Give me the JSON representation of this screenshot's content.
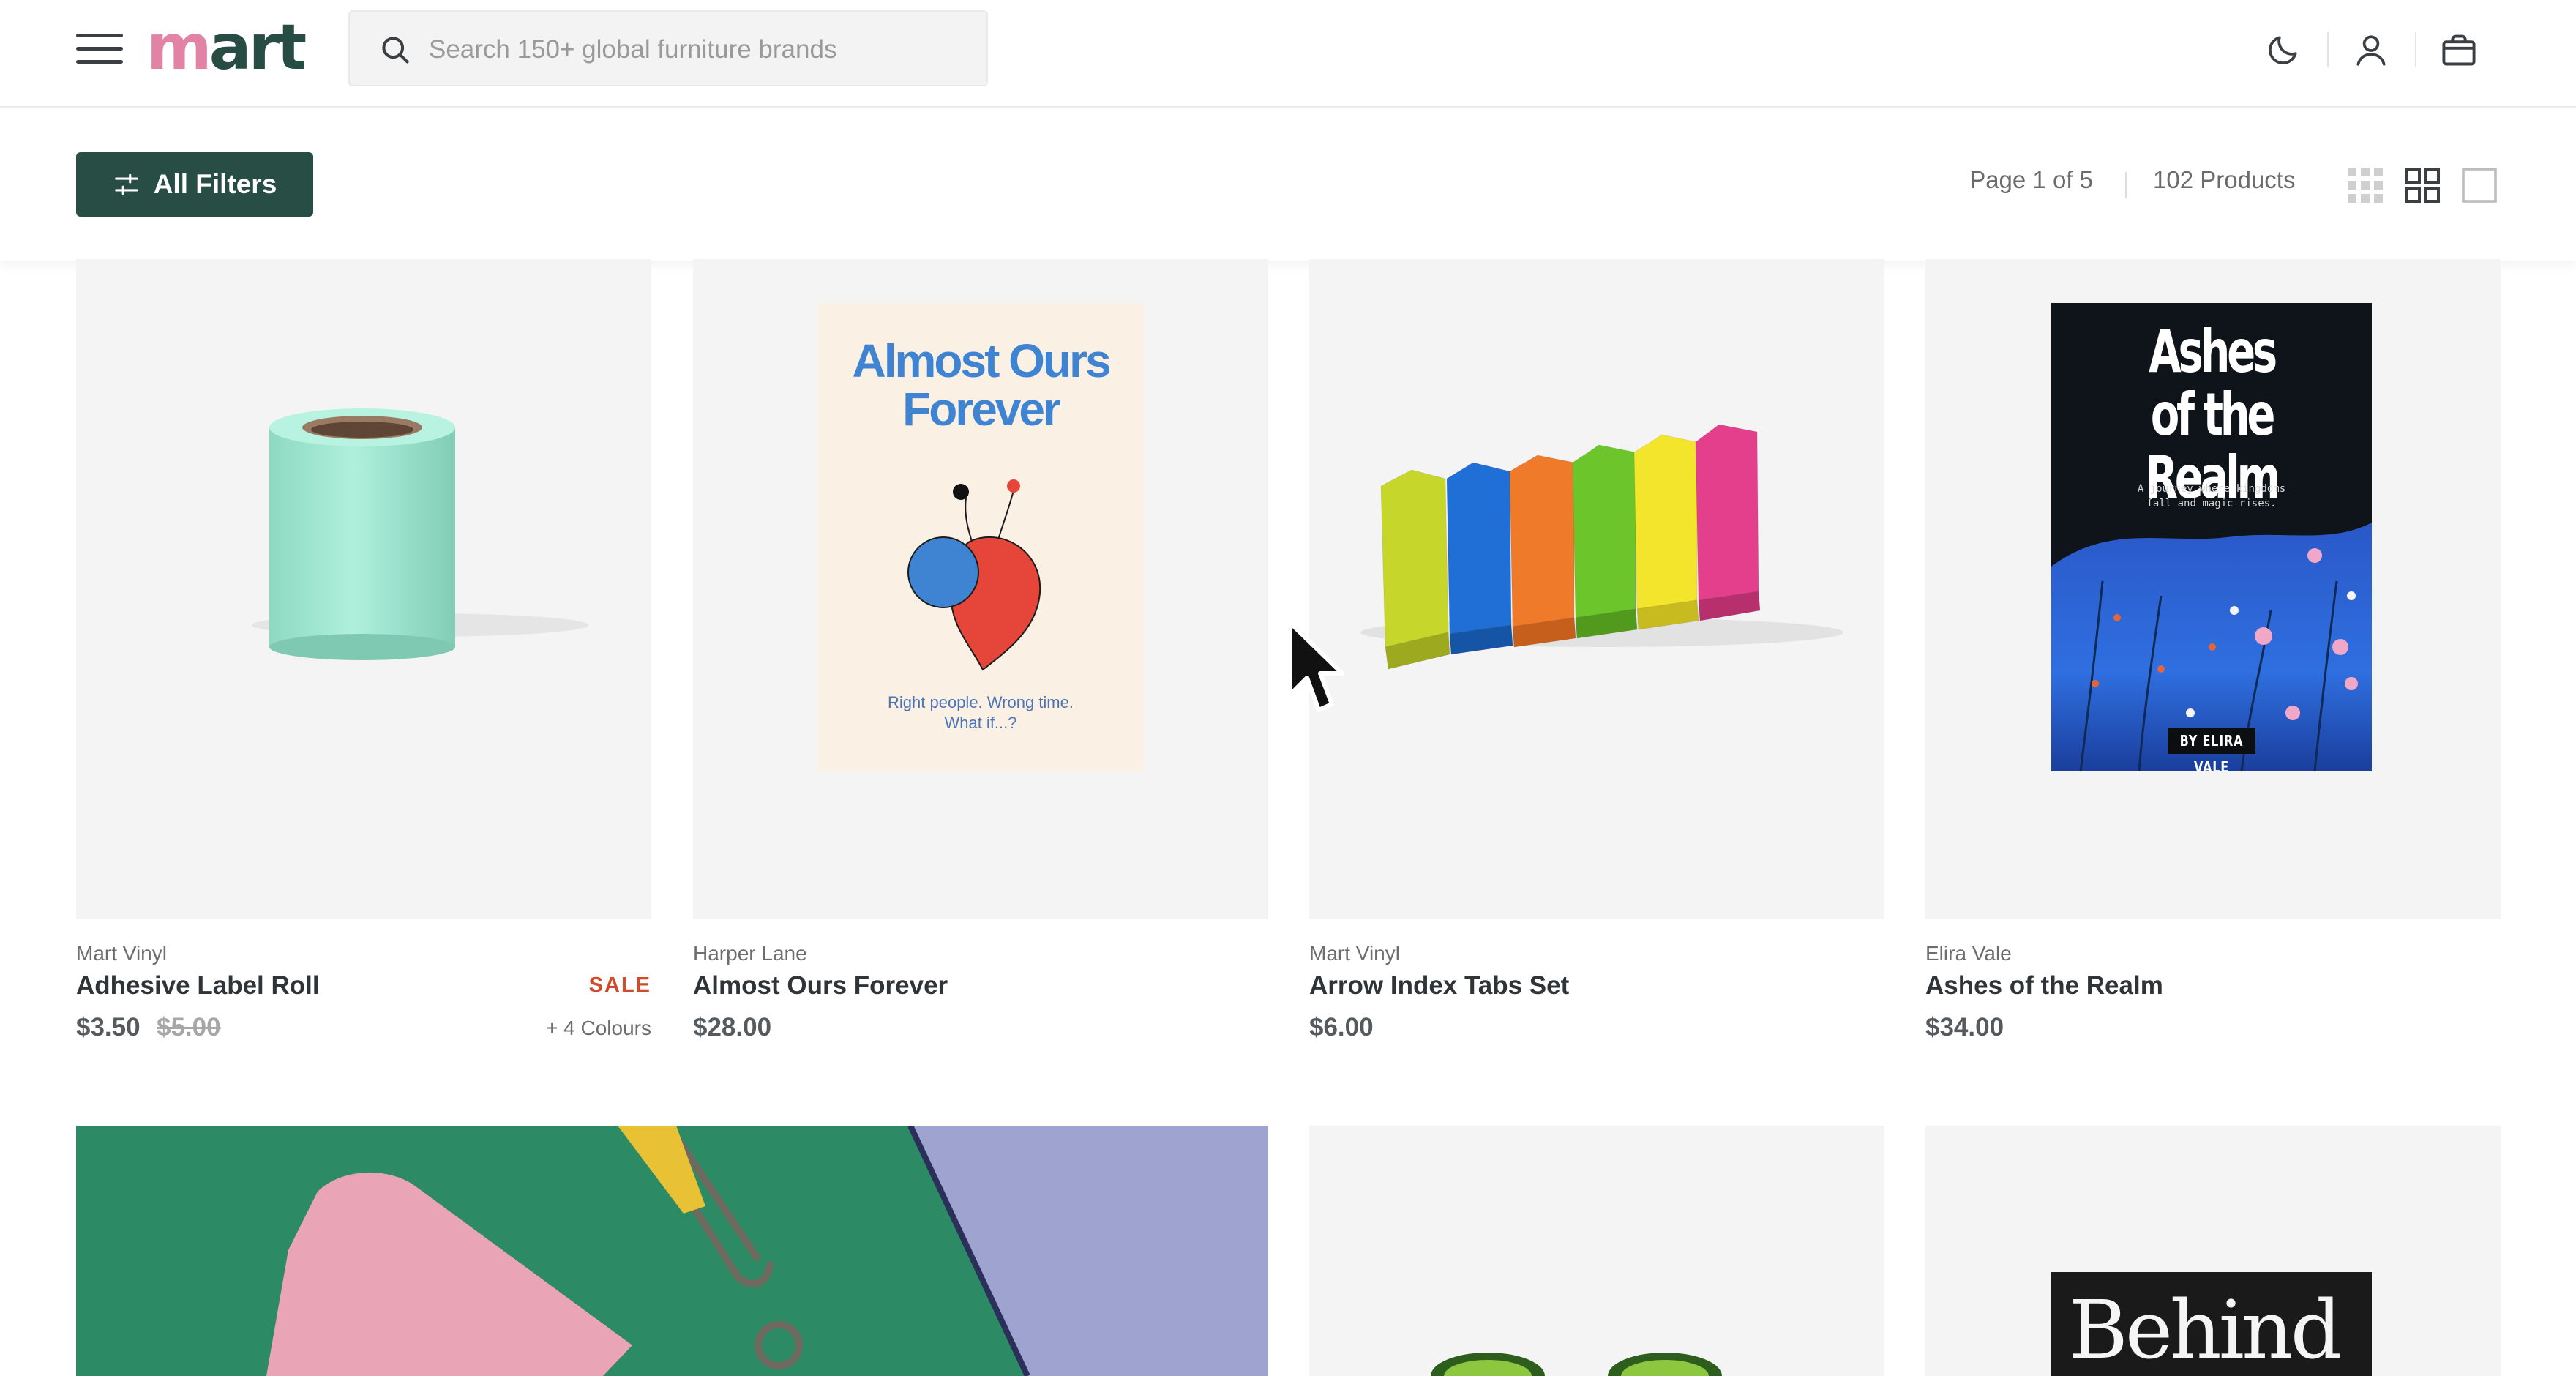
{
  "header": {
    "logo_part1": "m",
    "logo_part2": "art",
    "search_placeholder": "Search 150+ global furniture brands",
    "icons": [
      "menu-icon",
      "search-icon",
      "moon-icon",
      "user-icon",
      "bag-icon"
    ]
  },
  "toolbar": {
    "filters_label": "All Filters",
    "page_info": "Page 1 of 5",
    "product_count": "102 Products",
    "view_options": [
      "grid-small-view",
      "grid-medium-view",
      "single-view"
    ]
  },
  "products": [
    {
      "brand": "Mart Vinyl",
      "name": "Adhesive Label Roll",
      "price": "$3.50",
      "old_price": "$5.00",
      "badge": "SALE",
      "colours": "+ 4 Colours",
      "sale_color": "#cf4b2b"
    },
    {
      "brand": "Harper Lane",
      "name": "Almost Ours Forever",
      "price": "$28.00",
      "cover_title_line1": "Almost Ours",
      "cover_title_line2": "Forever",
      "cover_sub_line1": "Right people. Wrong time.",
      "cover_sub_line2": "What if...?"
    },
    {
      "brand": "Mart Vinyl",
      "name": "Arrow Index Tabs Set",
      "price": "$6.00"
    },
    {
      "brand": "Elira Vale",
      "name": "Ashes of the Realm",
      "price": "$34.00",
      "cover_title_line1": "Ashes",
      "cover_title_line2": "of the Realm",
      "cover_sub_line1": "A journey where kingdoms",
      "cover_sub_line2": "fall and magic rises.",
      "cover_author": "BY ELIRA VALE"
    }
  ],
  "row2": {
    "cover_title": "Behind"
  },
  "colors": {
    "brand_green": "#274d44",
    "logo_pink": "#e283a6",
    "sale_red": "#cf4b2b"
  }
}
